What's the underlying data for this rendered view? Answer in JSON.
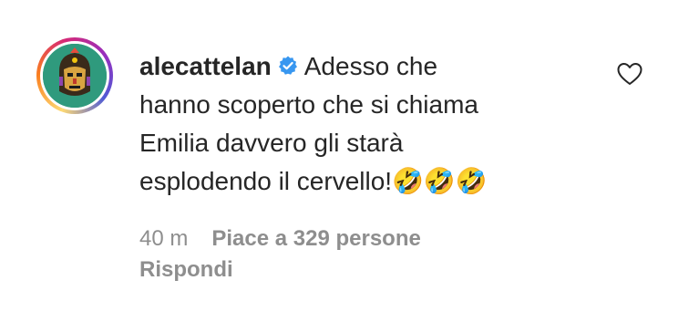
{
  "comment": {
    "username": "alecattelan",
    "verified_icon": "verified-badge-icon",
    "text": "Adesso che\nhanno scoperto che si chiama\nEmilia davvero gli starà\nesplodendo il cervello!🤣🤣🤣",
    "time": "40 m",
    "likes": "Piace a 329 persone",
    "reply": "Rispondi",
    "like_icon": "heart-outline-icon",
    "avatar_icon": "profile-avatar"
  },
  "colors": {
    "text": "#262626",
    "secondary": "#8e8e8e",
    "verified": "#3897f0",
    "avatar_bg": "#2f9a7d"
  }
}
